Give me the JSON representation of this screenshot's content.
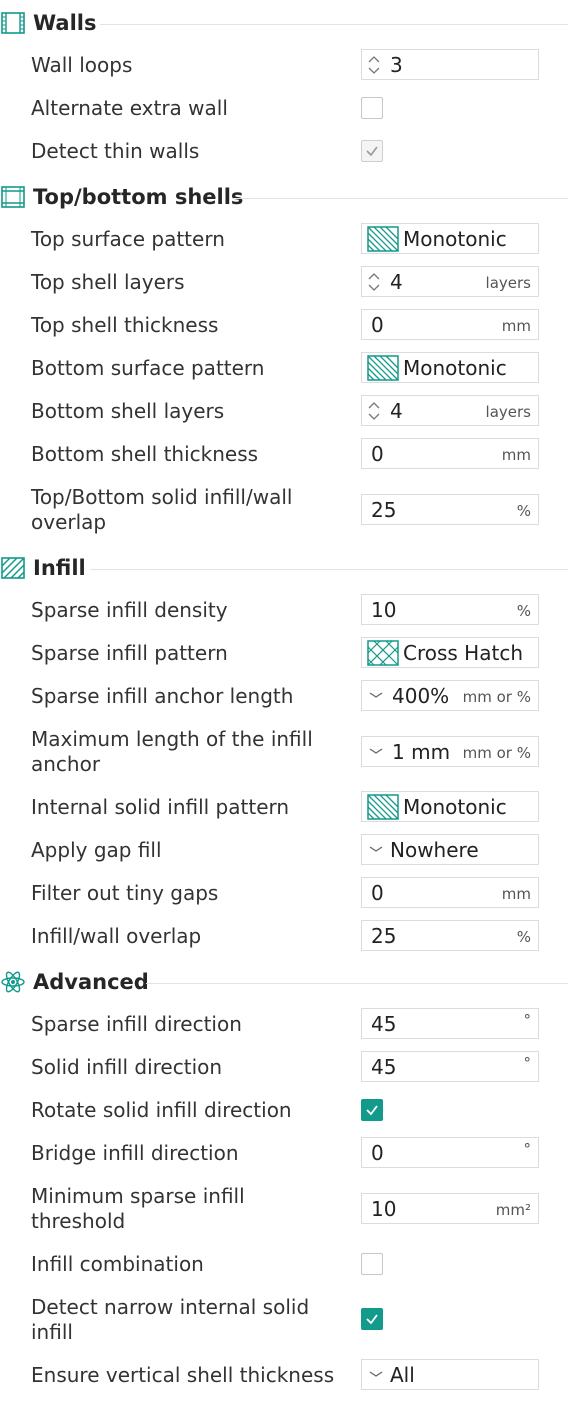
{
  "sections": {
    "walls": {
      "title": "Walls"
    },
    "shells": {
      "title": "Top/bottom shells"
    },
    "infill": {
      "title": "Infill"
    },
    "advanced": {
      "title": "Advanced"
    }
  },
  "walls": {
    "wall_loops": {
      "label": "Wall loops",
      "value": "3"
    },
    "alternate_extra_wall": {
      "label": "Alternate extra wall",
      "checked": false
    },
    "detect_thin_walls": {
      "label": "Detect thin walls",
      "checked": true,
      "disabled": true
    }
  },
  "shells": {
    "top_surface_pattern": {
      "label": "Top surface pattern",
      "value": "Monotonic",
      "icon": "monotonic-pattern-icon"
    },
    "top_shell_layers": {
      "label": "Top shell layers",
      "value": "4",
      "unit": "layers"
    },
    "top_shell_thickness": {
      "label": "Top shell thickness",
      "value": "0",
      "unit": "mm"
    },
    "bottom_surface_pattern": {
      "label": "Bottom surface pattern",
      "value": "Monotonic",
      "icon": "monotonic-pattern-icon"
    },
    "bottom_shell_layers": {
      "label": "Bottom shell layers",
      "value": "4",
      "unit": "layers"
    },
    "bottom_shell_thickness": {
      "label": "Bottom shell thickness",
      "value": "0",
      "unit": "mm"
    },
    "solid_overlap": {
      "label_line1": "Top/Bottom solid infill/wall",
      "label_line2": "overlap",
      "value": "25",
      "unit": "%"
    }
  },
  "infill": {
    "sparse_density": {
      "label": "Sparse infill density",
      "value": "10",
      "unit": "%"
    },
    "sparse_pattern": {
      "label": "Sparse infill pattern",
      "value": "Cross Hatch",
      "icon": "cross-hatch-pattern-icon"
    },
    "anchor_length": {
      "label": "Sparse infill anchor length",
      "value": "400%",
      "unit": "mm or %"
    },
    "max_anchor": {
      "label_line1": "Maximum length of the infill",
      "label_line2": "anchor",
      "value": "1 mm",
      "unit": "mm or %"
    },
    "internal_solid_pattern": {
      "label": "Internal solid infill pattern",
      "value": "Monotonic",
      "icon": "monotonic-pattern-icon"
    },
    "gap_fill": {
      "label": "Apply gap fill",
      "value": "Nowhere"
    },
    "filter_gaps": {
      "label": "Filter out tiny gaps",
      "value": "0",
      "unit": "mm"
    },
    "infill_wall_overlap": {
      "label": "Infill/wall overlap",
      "value": "25",
      "unit": "%"
    }
  },
  "advanced": {
    "sparse_direction": {
      "label": "Sparse infill direction",
      "value": "45",
      "unit": "°"
    },
    "solid_direction": {
      "label": "Solid infill direction",
      "value": "45",
      "unit": "°"
    },
    "rotate_solid": {
      "label": "Rotate solid infill direction",
      "checked": true
    },
    "bridge_direction": {
      "label": "Bridge infill direction",
      "value": "0",
      "unit": "°"
    },
    "min_sparse_threshold": {
      "label_line1": "Minimum sparse infill",
      "label_line2": "threshold",
      "value": "10",
      "unit": "mm²"
    },
    "infill_combination": {
      "label": "Infill combination",
      "checked": false
    },
    "detect_narrow_solid": {
      "label_line1": "Detect narrow internal solid",
      "label_line2": "infill",
      "checked": true
    },
    "vertical_shell": {
      "label": "Ensure vertical shell thickness",
      "value": "All"
    }
  },
  "colors": {
    "accent": "#129a8a",
    "border": "#dcdcdc",
    "text": "#333333"
  }
}
